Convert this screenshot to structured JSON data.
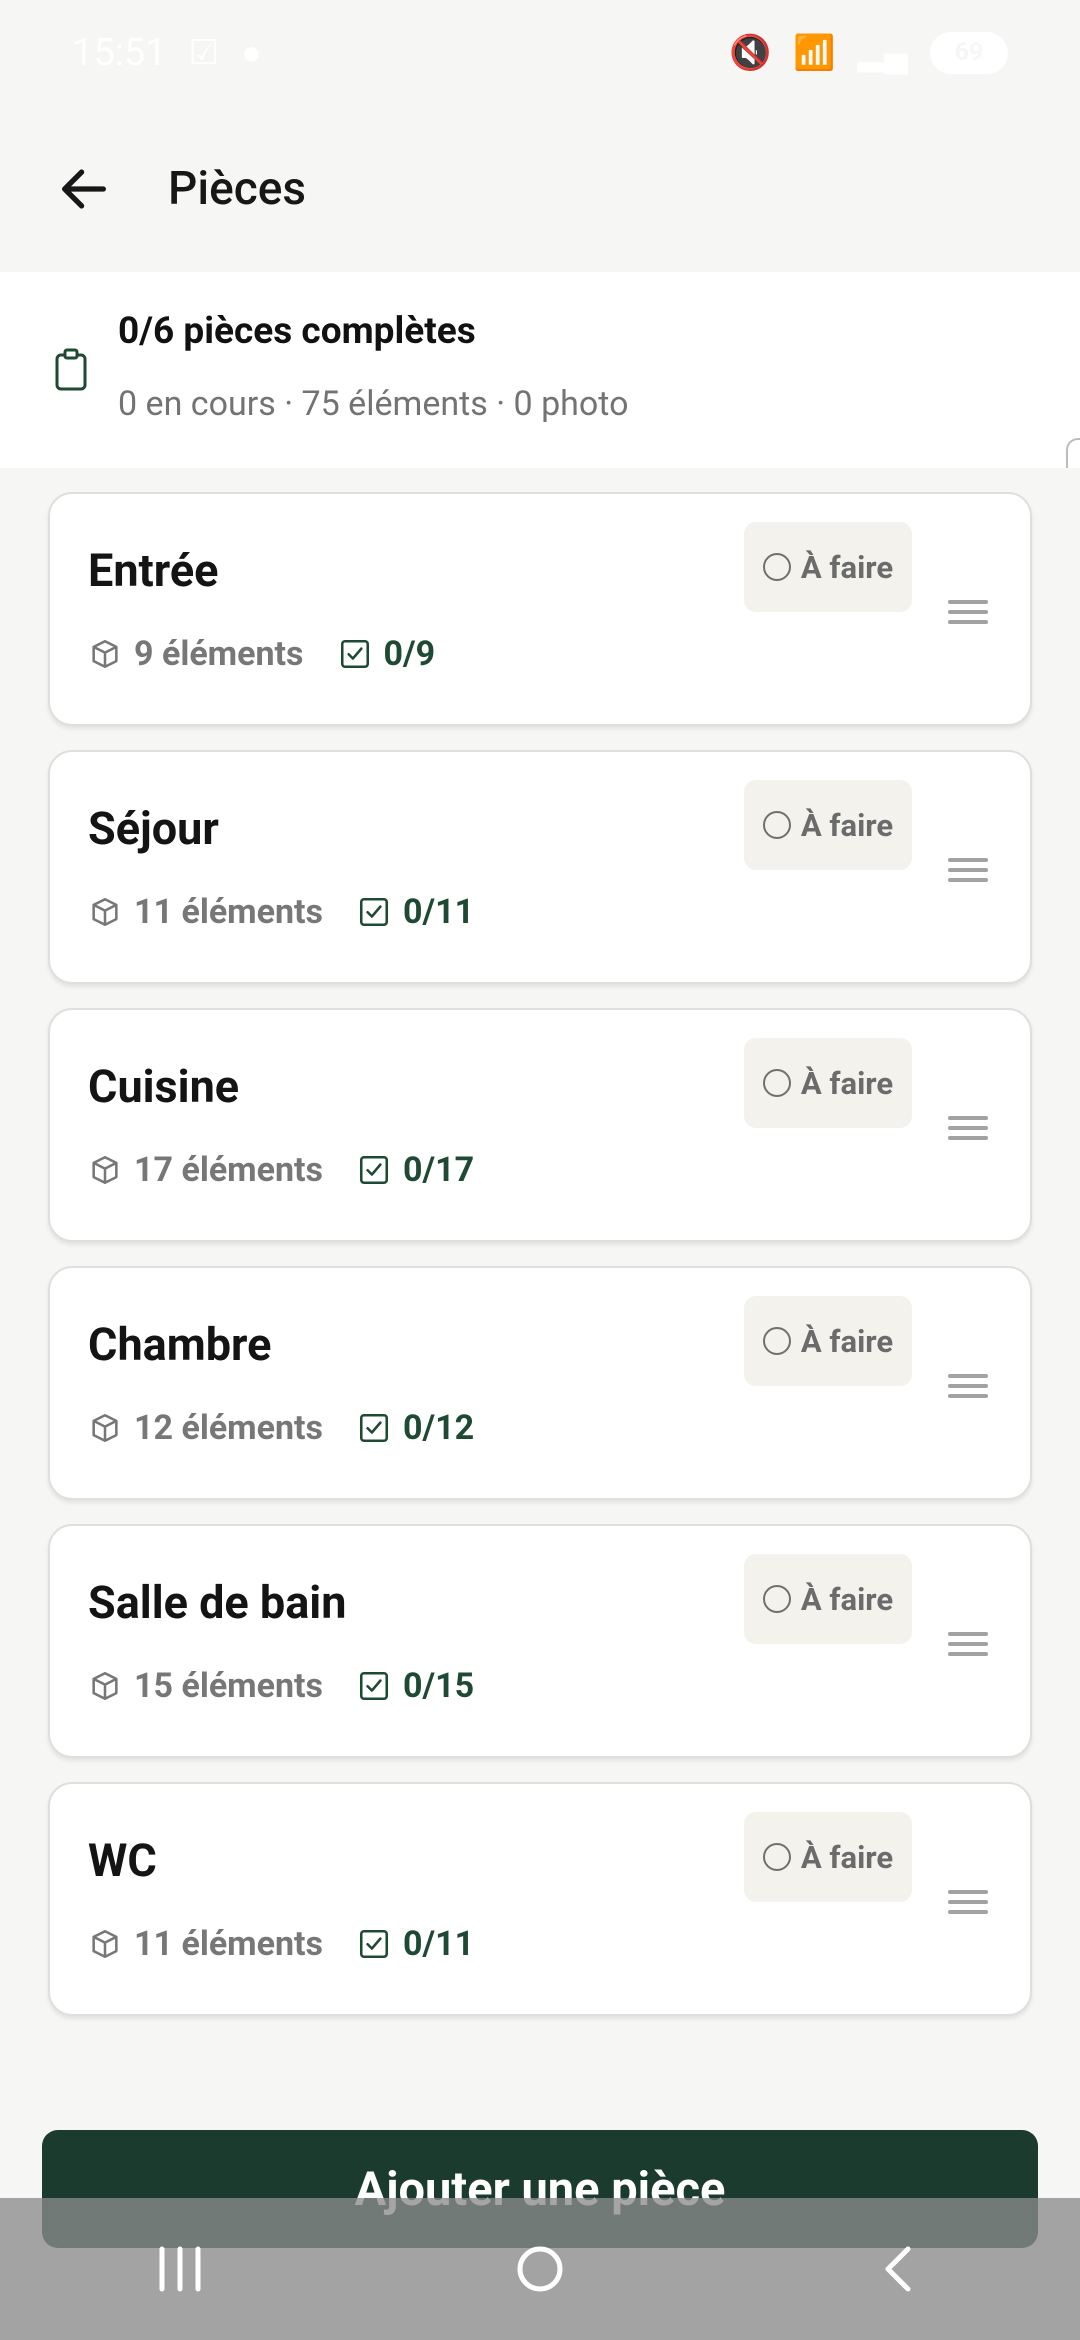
{
  "status_bar": {
    "time": "15:51",
    "battery": "69",
    "icons": [
      "notification-check-icon",
      "location-icon",
      "mute-icon",
      "wifi-icon",
      "signal-icon"
    ]
  },
  "header": {
    "title": "Pièces",
    "back_icon": "arrow-left-icon"
  },
  "summary": {
    "title": "0/6 pièces complètes",
    "subtitle": "0 en cours · 75 éléments · 0 photo",
    "icon": "clipboard-icon"
  },
  "rooms": [
    {
      "name": "Entrée",
      "status": "À faire",
      "elements": "9 éléments",
      "progress": "0/9"
    },
    {
      "name": "Séjour",
      "status": "À faire",
      "elements": "11 éléments",
      "progress": "0/11"
    },
    {
      "name": "Cuisine",
      "status": "À faire",
      "elements": "17 éléments",
      "progress": "0/17"
    },
    {
      "name": "Chambre",
      "status": "À faire",
      "elements": "12 éléments",
      "progress": "0/12"
    },
    {
      "name": "Salle de bain",
      "status": "À faire",
      "elements": "15 éléments",
      "progress": "0/15"
    },
    {
      "name": "WC",
      "status": "À faire",
      "elements": "11 éléments",
      "progress": "0/11"
    }
  ],
  "actions": {
    "add_room": "Ajouter une pièce"
  },
  "colors": {
    "accent": "#1a3b2e",
    "progress": "#1e4933",
    "background": "#f6f6f4",
    "chip_background": "#f3f2ec"
  },
  "navigation": {
    "items": [
      "recent-apps-icon",
      "home-icon",
      "back-icon"
    ]
  }
}
